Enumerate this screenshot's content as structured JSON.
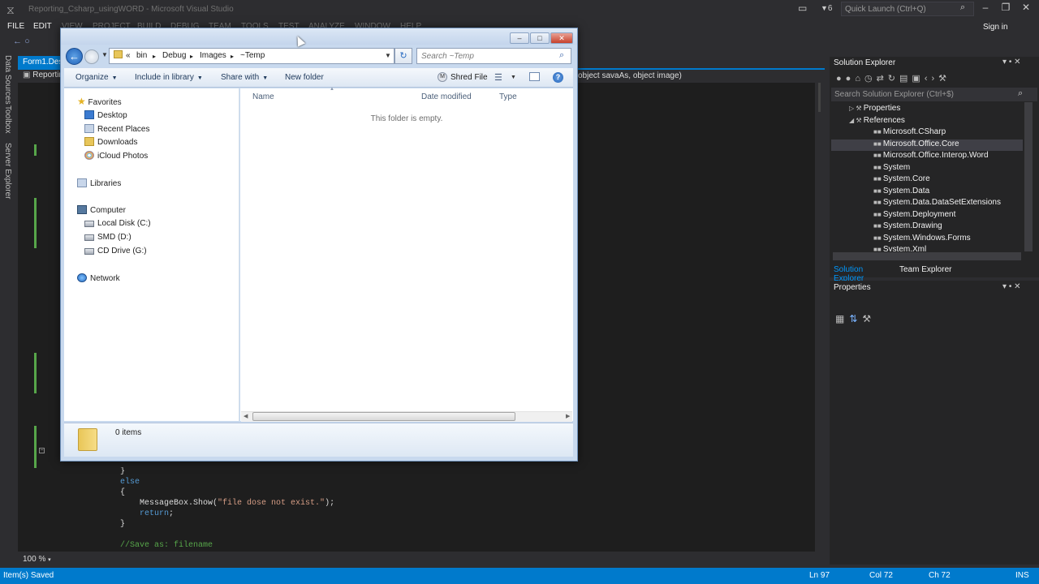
{
  "vs": {
    "window_title": "Reporting_Csharp_usingWORD - Microsoft Visual Studio",
    "notification_count": "6",
    "quick_launch_placeholder": "Quick Launch (Ctrl+Q)",
    "sign_in": "Sign in",
    "menu": [
      "FILE",
      "EDIT",
      "VIEW",
      "PROJECT",
      "BUILD",
      "DEBUG",
      "TEAM",
      "TOOLS",
      "TEST",
      "ANALYZE",
      "WINDOW",
      "HELP"
    ],
    "rail": [
      "Data Sources",
      "Toolbox",
      "Server Explorer"
    ],
    "doc_tab": "Form1.Designer.cs",
    "nav_left": "Reporting_Csharp_usingWORD",
    "nav_right": "object savaAs, object image)",
    "zoom": "100 %",
    "code_lines": [
      {
        "indent": "        ",
        "parts": [
          {
            "t": "}",
            "c": ""
          }
        ]
      },
      {
        "indent": "        ",
        "parts": [
          {
            "t": "else",
            "c": "kw"
          }
        ]
      },
      {
        "indent": "        ",
        "parts": [
          {
            "t": "{",
            "c": ""
          }
        ]
      },
      {
        "indent": "            ",
        "parts": [
          {
            "t": "MessageBox.Show(",
            "c": ""
          },
          {
            "t": "\"file dose not exist.\"",
            "c": "str"
          },
          {
            "t": ");",
            "c": ""
          }
        ]
      },
      {
        "indent": "            ",
        "parts": [
          {
            "t": "return",
            "c": "kw"
          },
          {
            "t": ";",
            "c": ""
          }
        ]
      },
      {
        "indent": "        ",
        "parts": [
          {
            "t": "}",
            "c": ""
          }
        ]
      },
      {
        "indent": "",
        "parts": [
          {
            "t": "",
            "c": ""
          }
        ]
      },
      {
        "indent": "        ",
        "parts": [
          {
            "t": "//Save as: filename",
            "c": "cmt"
          }
        ]
      }
    ]
  },
  "solution_explorer": {
    "title": "Solution Explorer",
    "search_placeholder": "Search Solution Explorer (Ctrl+$)",
    "items": [
      {
        "label": "Properties",
        "level": 1,
        "expander": "▷"
      },
      {
        "label": "References",
        "level": 1,
        "expander": "◢"
      },
      {
        "label": "Microsoft.CSharp",
        "level": 2
      },
      {
        "label": "Microsoft.Office.Core",
        "level": 2,
        "selected": true
      },
      {
        "label": "Microsoft.Office.Interop.Word",
        "level": 2
      },
      {
        "label": "System",
        "level": 2
      },
      {
        "label": "System.Core",
        "level": 2
      },
      {
        "label": "System.Data",
        "level": 2
      },
      {
        "label": "System.Data.DataSetExtensions",
        "level": 2
      },
      {
        "label": "System.Deployment",
        "level": 2
      },
      {
        "label": "System.Drawing",
        "level": 2
      },
      {
        "label": "System.Windows.Forms",
        "level": 2
      },
      {
        "label": "System.Xml",
        "level": 2
      }
    ],
    "tabs": [
      "Solution Explorer",
      "Team Explorer"
    ]
  },
  "properties": {
    "title": "Properties"
  },
  "status": {
    "message": "Item(s) Saved",
    "ln": "Ln 97",
    "col": "Col 72",
    "ch": "Ch 72",
    "mode": "INS"
  },
  "dialog": {
    "breadcrumbs": [
      "bin",
      "Debug",
      "Images",
      "~Temp"
    ],
    "search_placeholder": "Search ~Temp",
    "commands": {
      "organize": "Organize",
      "include": "Include in library",
      "share": "Share with",
      "new_folder": "New folder",
      "shred": "Shred File"
    },
    "nav": {
      "favorites": "Favorites",
      "favorites_items": [
        "Desktop",
        "Recent Places",
        "Downloads",
        "iCloud Photos"
      ],
      "libraries": "Libraries",
      "computer": "Computer",
      "drives": [
        "Local Disk (C:)",
        "SMD (D:)",
        "CD Drive (G:)"
      ],
      "network": "Network"
    },
    "columns": [
      "Name",
      "Date modified",
      "Type"
    ],
    "empty_message": "This folder is empty.",
    "item_count": "0 items"
  },
  "colors": {
    "vs_accent": "#007acc",
    "vs_background": "#2d2d30",
    "dialog_frame": "#c8d9ee"
  }
}
